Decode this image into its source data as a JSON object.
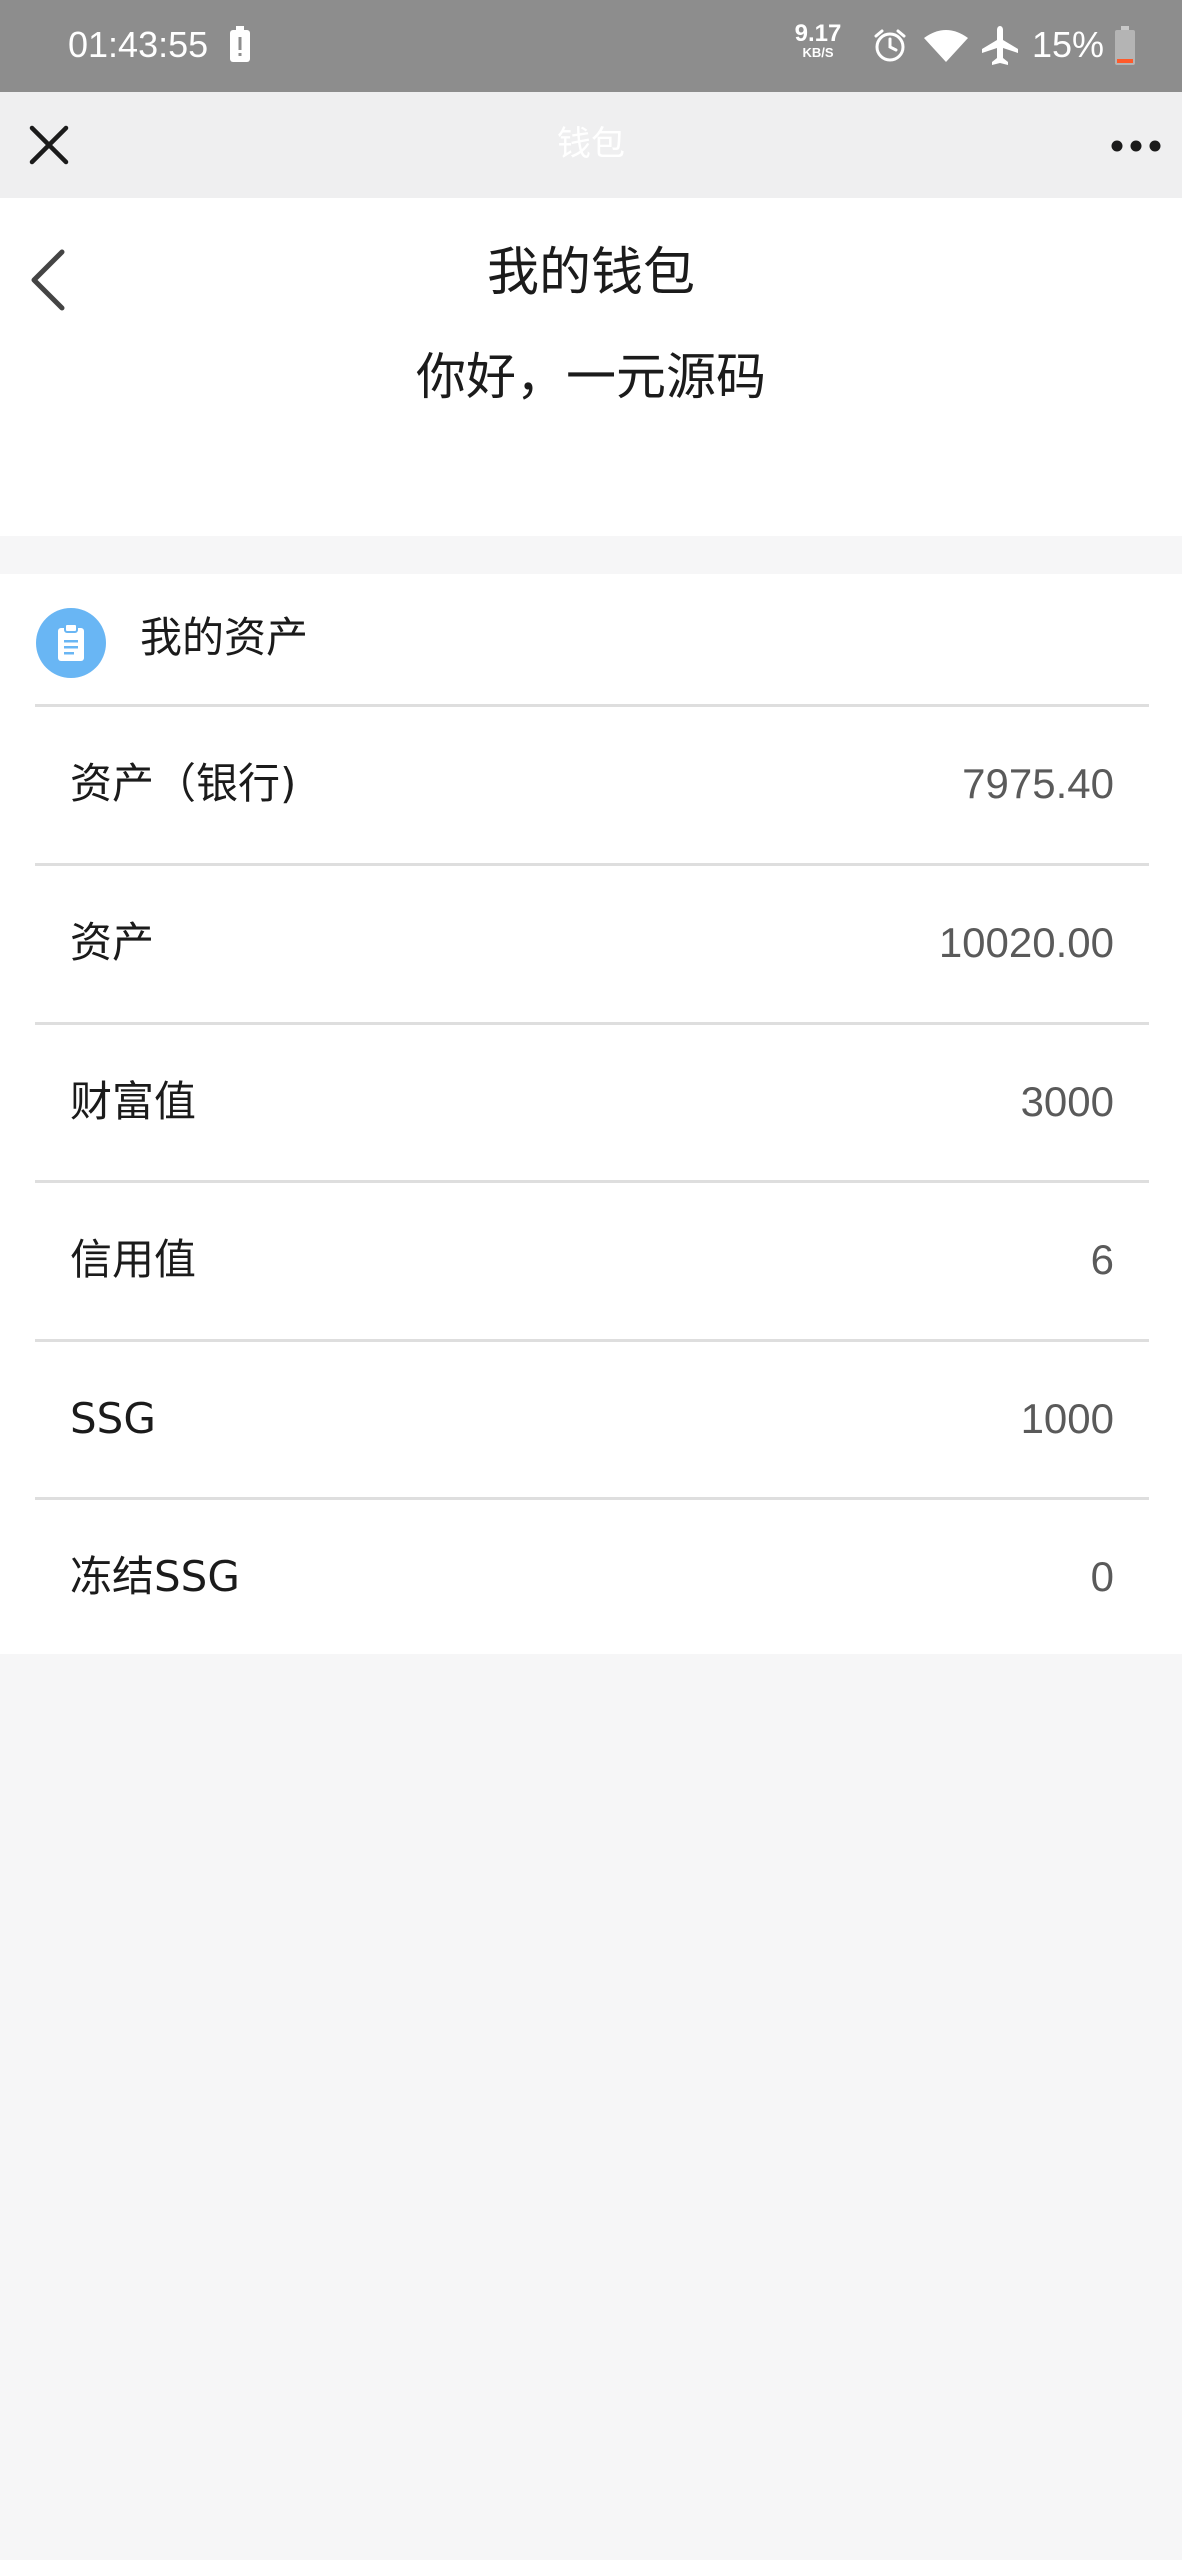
{
  "status_bar": {
    "time": "01:43:55",
    "net_speed_value": "9.17",
    "net_speed_unit": "KB/S",
    "battery_percent": "15%",
    "icons": [
      "notification-icon",
      "alarm-icon",
      "wifi-icon",
      "airplane-icon",
      "battery-icon"
    ]
  },
  "nav": {
    "title": "钱包",
    "close_icon": "close-icon",
    "more_icon": "more-icon"
  },
  "header": {
    "title": "我的钱包",
    "greeting": "你好，一元源码",
    "back_icon": "back-icon"
  },
  "assets": {
    "title": "我的资产",
    "icon": "clipboard-icon",
    "icon_color": "#69b6f4",
    "rows": [
      {
        "label": "资产（银行)",
        "value": "7975.40"
      },
      {
        "label": "资产",
        "value": "10020.00"
      },
      {
        "label": "财富值",
        "value": "3000"
      },
      {
        "label": "信用值",
        "value": "6"
      },
      {
        "label": "SSG",
        "value": "1000"
      },
      {
        "label": "冻结SSG",
        "value": "0"
      }
    ]
  }
}
